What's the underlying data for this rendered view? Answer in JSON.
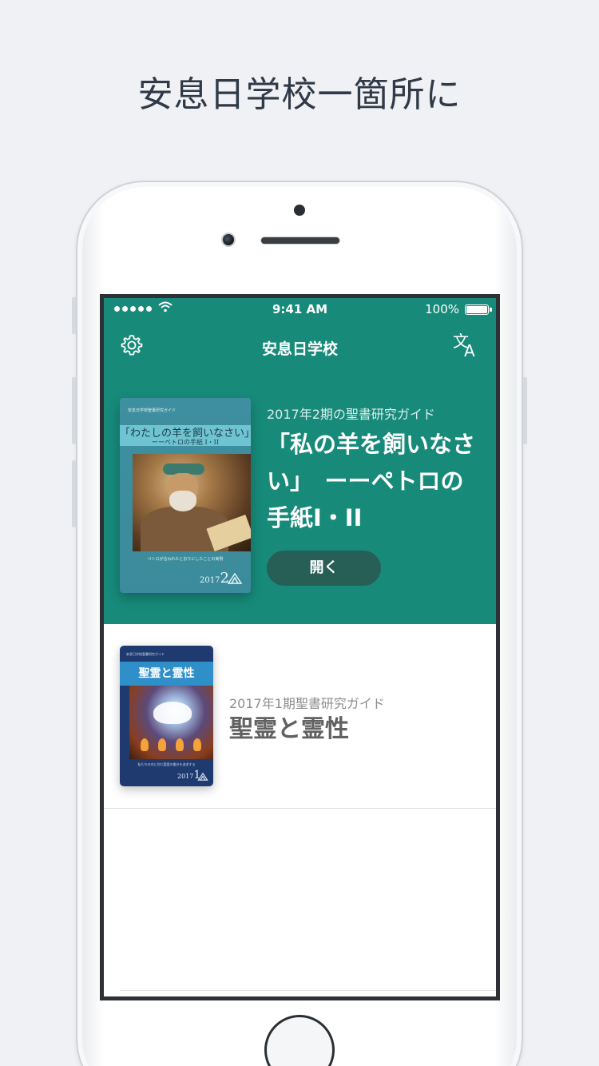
{
  "headline": "安息日学校一箇所に",
  "status_bar": {
    "time": "9:41 AM",
    "battery": "100%"
  },
  "nav": {
    "title": "安息日学校",
    "settings_icon": "gear-icon",
    "language_icon": "translate-icon",
    "language_glyph_a": "文",
    "language_glyph_b": "A"
  },
  "featured": {
    "subtitle": "2017年2期の聖書研究ガイド",
    "title": "「私の羊を飼いなさい」　ーーペトロの手紙I・II",
    "open_label": "開く",
    "cover": {
      "series": "安息日学校聖書研究ガイド",
      "title": "「わたしの羊を飼いなさい」",
      "subtitle": "ーーペトロの手紙 I・II",
      "caption": "ペトロが言われたとおりにしたことの実例",
      "year": "2017",
      "quarter": "2"
    }
  },
  "list": [
    {
      "subtitle": "2017年1期聖書研究ガイド",
      "title": "聖霊と霊性",
      "cover": {
        "series": "安息日学校聖書研究ガイド",
        "title": "聖霊と霊性",
        "caption": "私たちの内に住む聖霊の働きを追求する",
        "year": "2017",
        "quarter": "1"
      }
    }
  ],
  "colors": {
    "hero": "#178a7a",
    "button": "#275e55",
    "background": "#eff1f4"
  }
}
